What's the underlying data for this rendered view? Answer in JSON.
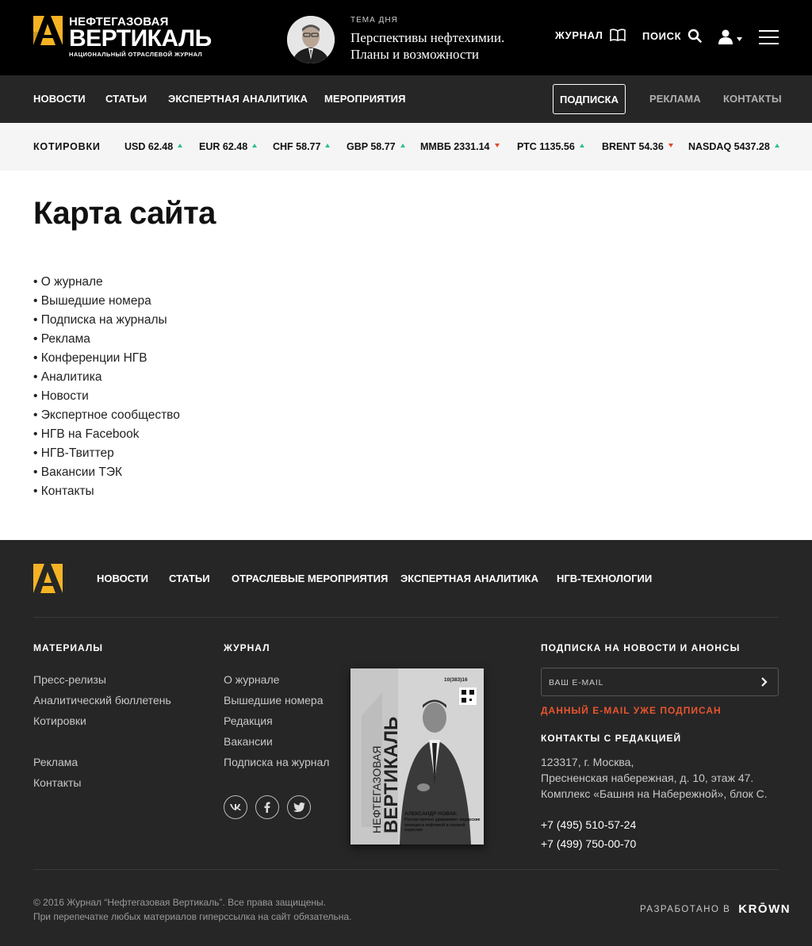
{
  "header": {
    "logo_top": "НЕФТЕГАЗОВАЯ",
    "logo_main": "ВЕРТИКАЛЬ",
    "logo_sub": "НАЦИОНАЛЬНЫЙ ОТРАСЛЕВОЙ ЖУРНАЛ",
    "topic_label": "ТЕМА ДНЯ",
    "topic_title_line1": "Перспективы нефтехимии.",
    "topic_title_line2": "Планы и возможности",
    "journal_label": "ЖУРНАЛ",
    "search_label": "ПОИСК"
  },
  "main_nav": {
    "news": "НОВОСТИ",
    "articles": "СТАТЬИ",
    "analytics": "ЭКСПЕРТНАЯ АНАЛИТИКА",
    "events": "МЕРОПРИЯТИЯ",
    "subscribe": "ПОДПИСКА",
    "ads": "РЕКЛАМА",
    "contacts": "КОНТАКТЫ"
  },
  "quotes": {
    "label": "КОТИРОВКИ",
    "items": [
      {
        "text": "USD 62.48",
        "trend": "up"
      },
      {
        "text": "EUR 62.48",
        "trend": "up"
      },
      {
        "text": "CHF 58.77",
        "trend": "up"
      },
      {
        "text": "GBP 58.77",
        "trend": "up"
      },
      {
        "text": "ММВБ 2331.14",
        "trend": "down"
      },
      {
        "text": "РТС 1135.56",
        "trend": "up"
      },
      {
        "text": "BRENT 54.36",
        "trend": "down"
      },
      {
        "text": "NASDAQ 5437.28",
        "trend": "up"
      }
    ]
  },
  "content": {
    "title": "Карта сайта",
    "links": [
      "О журнале",
      "Вышедшие номера",
      "Подписка на журналы",
      "Реклама",
      "Конференции НГВ",
      "Аналитика",
      "Новости",
      "Экспертное сообщество",
      "НГВ на Facebook",
      "НГВ-Твиттер",
      "Вакансии ТЭК",
      "Контакты"
    ]
  },
  "footer": {
    "nav": [
      "НОВОСТИ",
      "СТАТЬИ",
      "ОТРАСЛЕВЫЕ МЕРОПРИЯТИЯ",
      "ЭКСПЕРТНАЯ АНАЛИТИКА",
      "НГВ-ТЕХНОЛОГИИ"
    ],
    "materials_title": "МАТЕРИАЛЫ",
    "materials": [
      "Пресс-релизы",
      "Аналитический бюллетень",
      "Котировки",
      "Реклама",
      "Контакты"
    ],
    "journal_title": "ЖУРНАЛ",
    "journal": [
      "О журнале",
      "Вышедшие номера",
      "Редакция",
      "Вакансии",
      "Подписка на журнал"
    ],
    "magazine": {
      "issue": "10(383)16",
      "title_top": "НЕФТЕГАЗОВАЯ",
      "title_main": "ВЕРТИКАЛЬ",
      "headline": "АЛЕКСАНДР НОВАК:",
      "subline": "Россия прочно удерживает лидерские позиции в нефтяной и газовой отраслях"
    },
    "subscribe_title": "ПОДПИСКА НА НОВОСТИ И АНОНСЫ",
    "email_placeholder": "ВАШ E-MAIL",
    "email_error": "ДАННЫЙ E-MAIL УЖЕ ПОДПИСАН",
    "contacts_title": "КОНТАКТЫ С РЕДАКЦИЕЙ",
    "address_line1": "123317, г. Москва,",
    "address_line2": "Пресненская набережная, д. 10, этаж 47.",
    "address_line3": "Комплекс «Башня на Набережной», блок С.",
    "phone1": "+7 (495) 510-57-24",
    "phone2": "+7 (499) 750-00-70",
    "copyright_line1": "© 2016 Журнал “Нефтегазовая Вертикаль”. Все права защищены.",
    "copyright_line2": "При перепечатке любых материалов гиперссылка на сайт обязательна.",
    "developed_by": "РАЗРАБОТАНО В",
    "developer": "KRŌWN"
  },
  "colors": {
    "brand_yellow": "#f5b324",
    "trend_up": "#2fbf8f",
    "trend_down": "#e24a2c",
    "error": "#e8552f"
  }
}
